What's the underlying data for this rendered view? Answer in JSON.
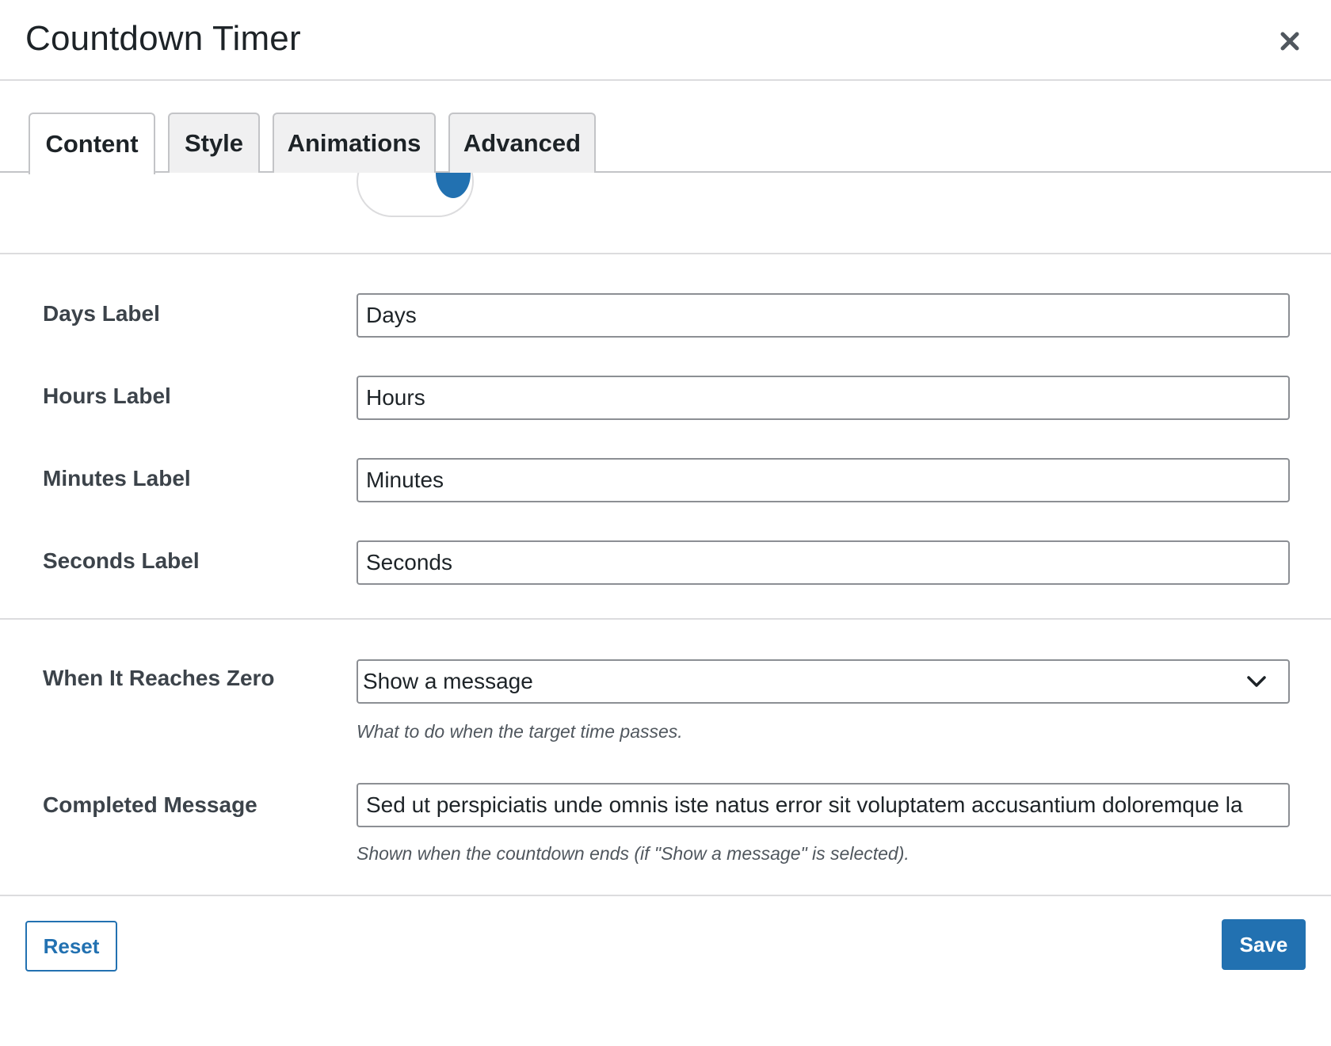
{
  "modal": {
    "title": "Countdown Timer",
    "close_icon": "close-icon"
  },
  "tabs": [
    {
      "label": "Content",
      "active": true
    },
    {
      "label": "Style",
      "active": false
    },
    {
      "label": "Animations",
      "active": false
    },
    {
      "label": "Advanced",
      "active": false
    }
  ],
  "toggle": {
    "state": "on",
    "color": "#2271b1"
  },
  "fields": {
    "days": {
      "label": "Days Label",
      "value": "Days"
    },
    "hours": {
      "label": "Hours Label",
      "value": "Hours"
    },
    "minutes": {
      "label": "Minutes Label",
      "value": "Minutes"
    },
    "seconds": {
      "label": "Seconds Label",
      "value": "Seconds"
    },
    "zero": {
      "label": "When It Reaches Zero",
      "selected": "Show a message",
      "help": "What to do when the target time passes."
    },
    "completed": {
      "label": "Completed Message",
      "value": "Sed ut perspiciatis unde omnis iste natus error sit voluptatem accusantium doloremque la",
      "help": "Shown when the countdown ends (if \"Show a message\" is selected)."
    }
  },
  "footer": {
    "reset_label": "Reset",
    "save_label": "Save"
  },
  "colors": {
    "accent": "#2271b1",
    "text": "#1d2327",
    "border": "#8c8f94"
  }
}
